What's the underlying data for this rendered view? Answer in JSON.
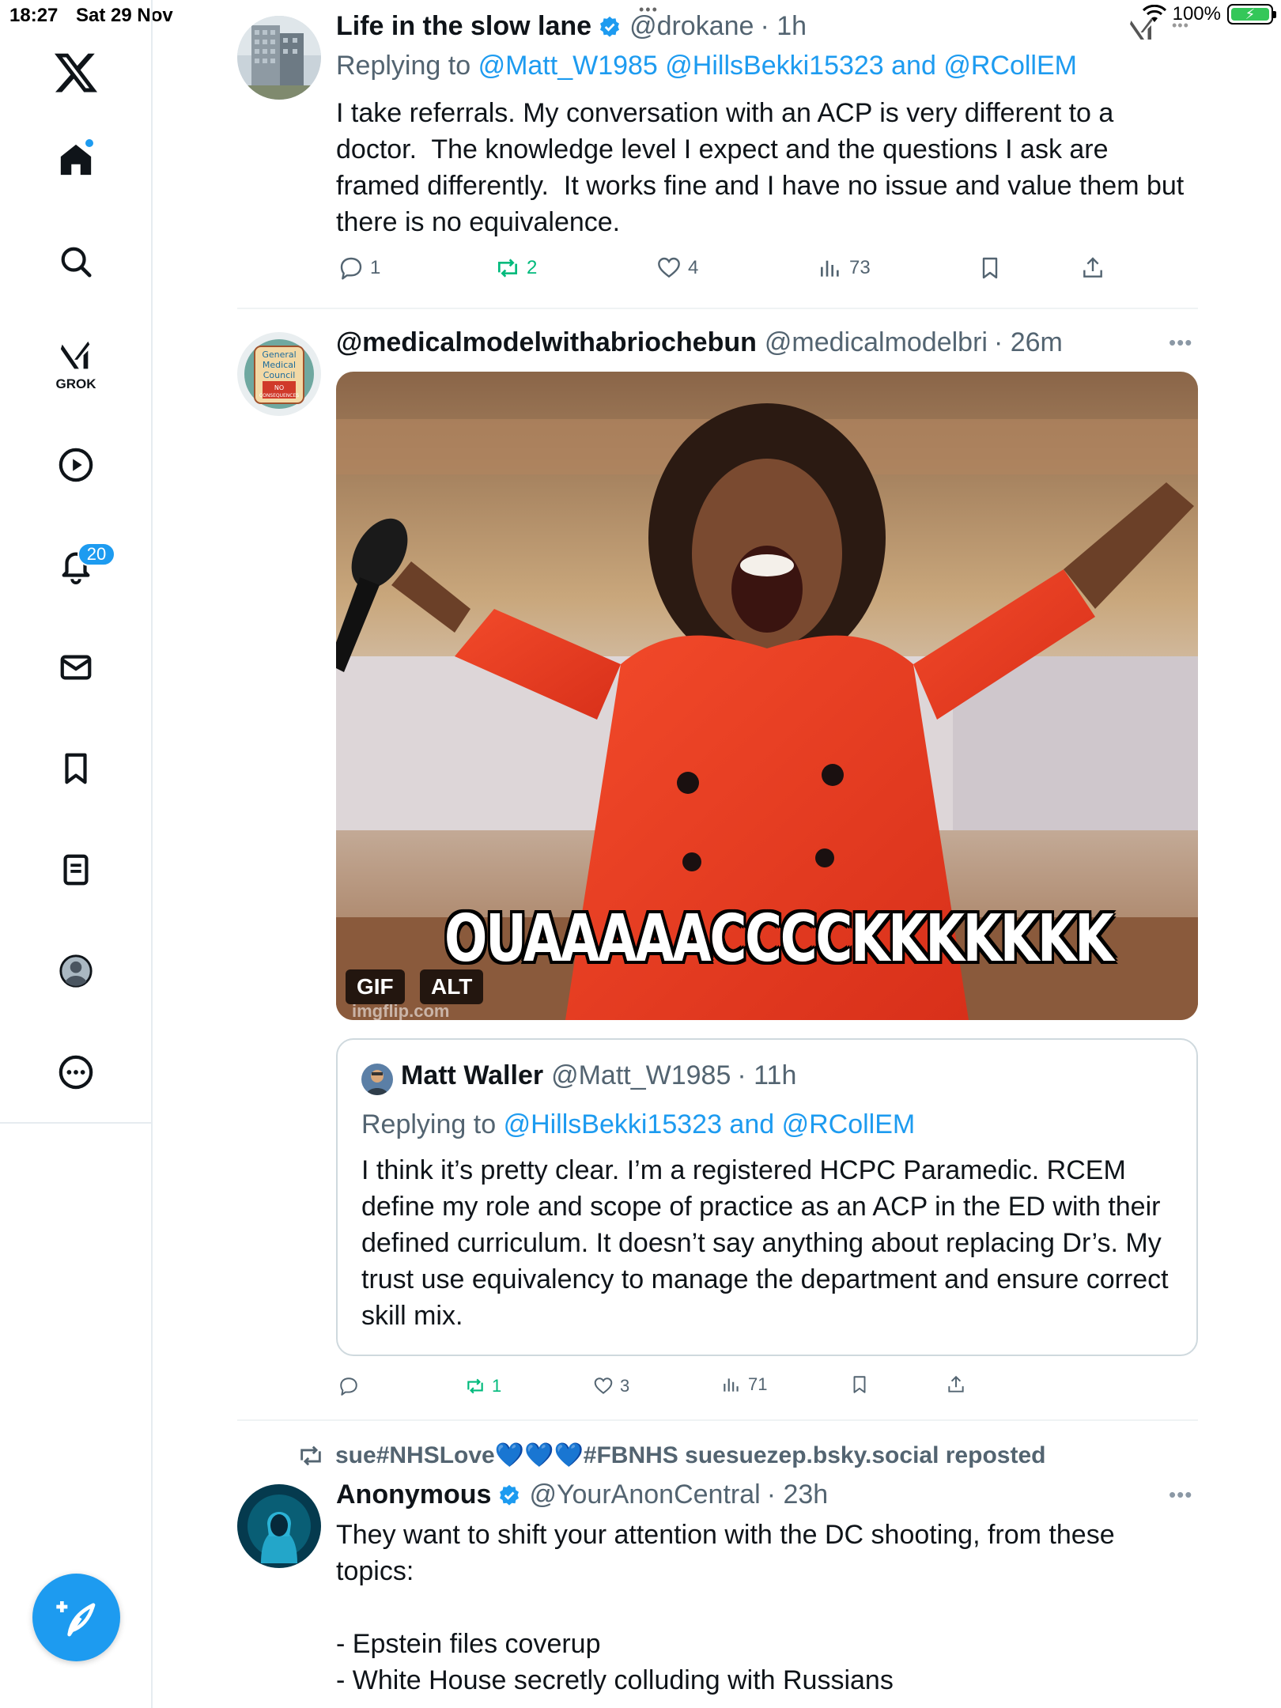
{
  "status_bar": {
    "time": "18:27",
    "date": "Sat 29 Nov",
    "battery": "100%"
  },
  "sidebar": {
    "grok_label": "GROK",
    "notifications_count": "20",
    "items": [
      "home-icon",
      "search-icon",
      "grok-icon",
      "video-icon",
      "notifications-icon",
      "messages-icon",
      "bookmarks-icon",
      "lists-icon",
      "profile-icon",
      "more-icon"
    ]
  },
  "tweets": [
    {
      "name": "Life in the slow lane",
      "verified": true,
      "handle": "@drokane",
      "time": "· 1h",
      "replying_prefix": "Replying to",
      "replying_to": "@Matt_W1985 @HillsBekki15323 and @RCollEM",
      "text": "I take referrals. My conversation with an ACP is very different to a doctor.  The knowledge level I expect and the questions I ask are framed differently.  It works fine and I have no issue and value them but there is no equivalence.",
      "replies": "1",
      "reposts": "2",
      "likes": "4",
      "views": "73"
    },
    {
      "name": "@medicalmodelwithabriochebun",
      "handle": "@medicalmodelbri",
      "time": "· 26m",
      "media": {
        "caption": "OUAAAAACCCCKKKKKKK",
        "gif_badge": "GIF",
        "alt_badge": "ALT",
        "watermark": "imgflip.com"
      },
      "avatar_text": [
        "General",
        "Medical",
        "Council",
        "NO",
        "CONSEQUENCES"
      ],
      "quote": {
        "name": "Matt Waller",
        "handle": "@Matt_W1985",
        "time": "· 11h",
        "replying_prefix": "Replying to",
        "replying_to": "@HillsBekki15323 and @RCollEM",
        "text": "I think it’s pretty clear. I’m a registered HCPC Paramedic. RCEM define my role and scope of practice as an ACP in the ED with their defined curriculum. It doesn’t say anything about replacing Dr’s. My trust use equivalency to manage the department and ensure correct skill mix."
      },
      "replies": "",
      "reposts": "1",
      "likes": "3",
      "views": "71"
    },
    {
      "repost_by": "sue#NHSLove💙💙💙#FBNHS suesuezep.bsky.social reposted",
      "name": "Anonymous",
      "verified": true,
      "handle": "@YourAnonCentral",
      "time": "· 23h",
      "text": "They want to shift your attention with the DC shooting, from these topics:\n\n- Epstein files coverup\n- White House secretly colluding with Russians"
    }
  ],
  "colors": {
    "accent": "#1d9bf0",
    "repost": "#00ba7c",
    "secondary_text": "#536471"
  }
}
